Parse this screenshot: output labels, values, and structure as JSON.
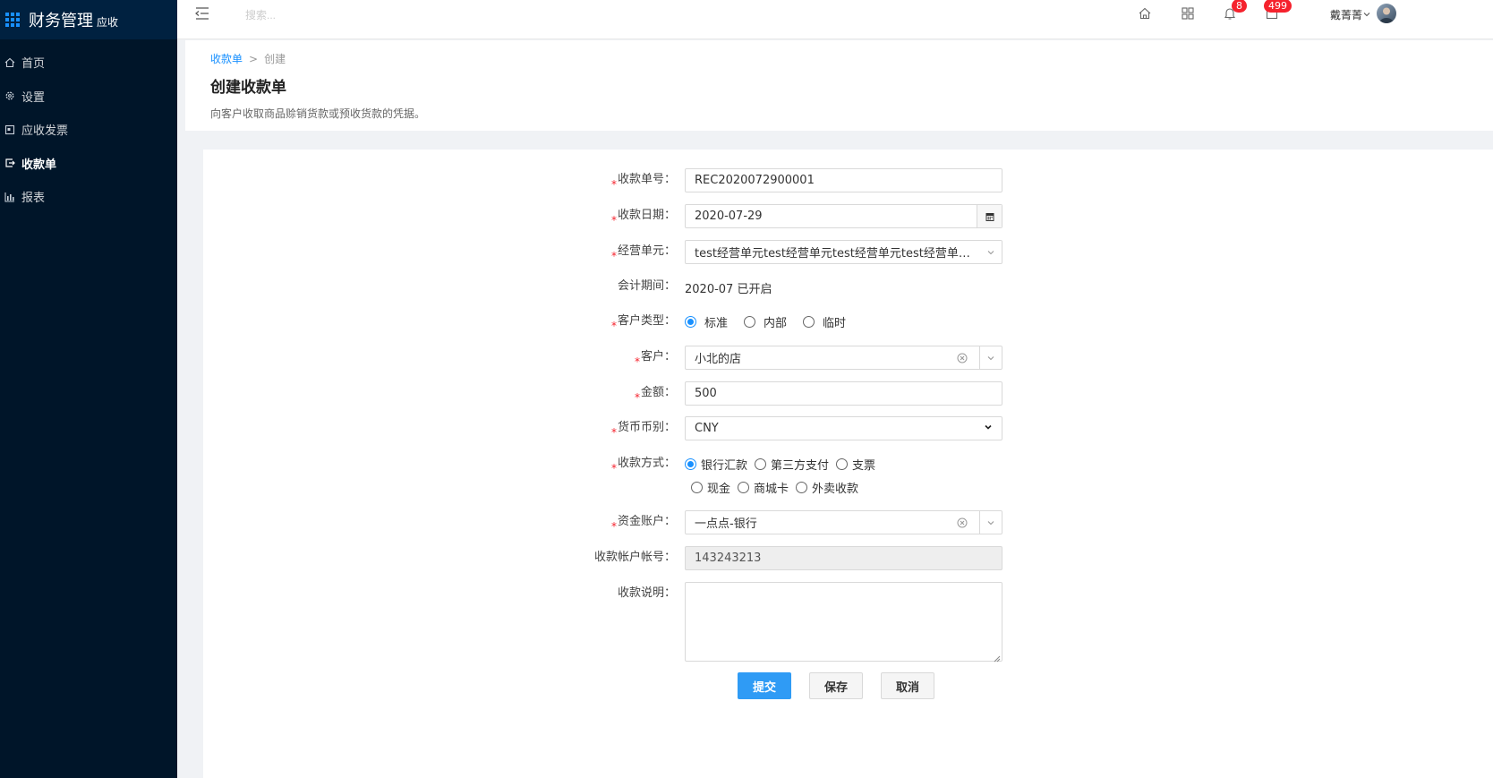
{
  "brand": {
    "title": "财务管理",
    "subtitle": "应收"
  },
  "sidebar": {
    "items": [
      {
        "label": "首页",
        "icon": "home-icon",
        "active": false
      },
      {
        "label": "设置",
        "icon": "gear-icon",
        "active": false
      },
      {
        "label": "应收发票",
        "icon": "invoice-icon",
        "active": false
      },
      {
        "label": "收款单",
        "icon": "receipt-icon",
        "active": true
      },
      {
        "label": "报表",
        "icon": "bar-chart-icon",
        "active": false
      }
    ]
  },
  "header": {
    "search_placeholder": "搜索...",
    "notifications_count": "8",
    "messages_count": "499",
    "user_name": "戴菁菁"
  },
  "page": {
    "breadcrumb_root": "收款单",
    "breadcrumb_sep": ">",
    "breadcrumb_current": "创建",
    "title": "创建收款单",
    "description": "向客户收取商品赊销货款或预收货款的凭据。"
  },
  "form": {
    "receipt_no": {
      "label": "收款单号：",
      "value": "REC2020072900001"
    },
    "receipt_date": {
      "label": "收款日期：",
      "value": "2020-07-29"
    },
    "business_unit": {
      "label": "经营单元：",
      "value": "test经营单元test经营单元test经营单元test经营单元test经营单元"
    },
    "accounting_period": {
      "label": "会计期间：",
      "value": "2020-07 已开启"
    },
    "customer_type": {
      "label": "客户类型：",
      "options": [
        "标准",
        "内部",
        "临时"
      ],
      "selected": "标准"
    },
    "customer": {
      "label": "客户：",
      "value": "小北的店"
    },
    "amount": {
      "label": "金额：",
      "value": "500"
    },
    "currency": {
      "label": "货币币别：",
      "value": "CNY"
    },
    "payment_method": {
      "label": "收款方式：",
      "options": [
        "银行汇款",
        "第三方支付",
        "支票",
        "现金",
        "商城卡",
        "外卖收款"
      ],
      "selected": "银行汇款"
    },
    "fund_account": {
      "label": "资金账户：",
      "value": "一点点-银行"
    },
    "account_no": {
      "label": "收款帐户帐号：",
      "value": "143243213"
    },
    "remark": {
      "label": "收款说明：",
      "value": ""
    },
    "required_mark": "*"
  },
  "buttons": {
    "submit": "提交",
    "save": "保存",
    "cancel": "取消"
  },
  "colors": {
    "sidebar_bg": "#001529",
    "primary": "#1890ff",
    "required": "#f5222d",
    "badge": "#f5222d"
  }
}
